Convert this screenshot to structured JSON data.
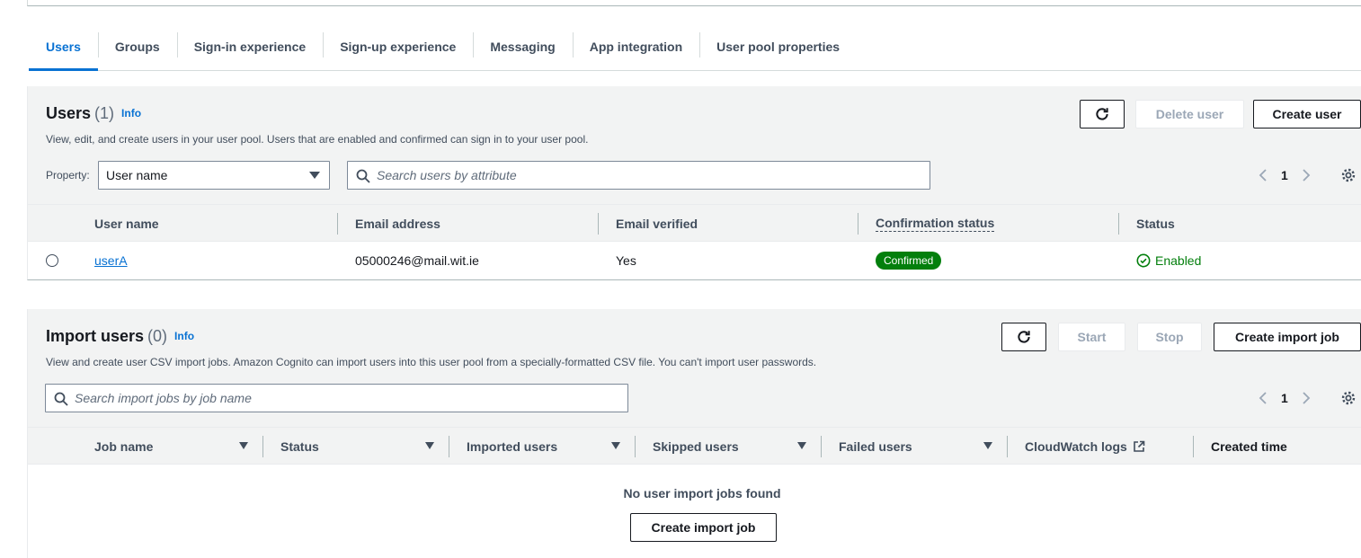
{
  "tabs": [
    {
      "label": "Users"
    },
    {
      "label": "Groups"
    },
    {
      "label": "Sign-in experience"
    },
    {
      "label": "Sign-up experience"
    },
    {
      "label": "Messaging"
    },
    {
      "label": "App integration"
    },
    {
      "label": "User pool properties"
    }
  ],
  "users_panel": {
    "title": "Users",
    "count": "(1)",
    "info": "Info",
    "description": "View, edit, and create users in your user pool. Users that are enabled and confirmed can sign in to your user pool.",
    "delete_label": "Delete user",
    "create_label": "Create user",
    "property_label": "Property:",
    "property_value": "User name",
    "search_placeholder": "Search users by attribute",
    "page": "1",
    "columns": [
      "User name",
      "Email address",
      "Email verified",
      "Confirmation status",
      "Status"
    ],
    "rows": [
      {
        "username": "userA",
        "email": "05000246@mail.wit.ie",
        "verified": "Yes",
        "confirmation": "Confirmed",
        "status": "Enabled"
      }
    ]
  },
  "import_panel": {
    "title": "Import users",
    "count": "(0)",
    "info": "Info",
    "description": "View and create user CSV import jobs. Amazon Cognito can import users into this user pool from a specially-formatted CSV file. You can't import user passwords.",
    "start_label": "Start",
    "stop_label": "Stop",
    "create_label": "Create import job",
    "search_placeholder": "Search import jobs by job name",
    "page": "1",
    "columns": [
      "Job name",
      "Status",
      "Imported users",
      "Skipped users",
      "Failed users",
      "CloudWatch logs",
      "Created time"
    ],
    "empty_text": "No user import jobs found",
    "empty_button": "Create import job"
  },
  "colors": {
    "accent": "#0972d3",
    "success": "#037f0c"
  }
}
